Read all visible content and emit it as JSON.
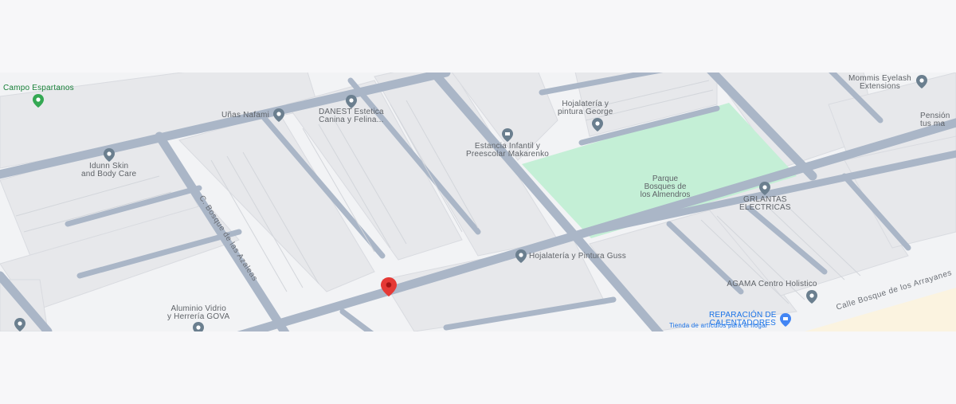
{
  "map": {
    "colors": {
      "background": "#f2f3f5",
      "block": "#e8e9ec",
      "road": "#aab6c7",
      "park": "#c4efd6",
      "pin_gray": "#6b7f8f",
      "pin_red": "#e53935",
      "pin_green": "#34a853",
      "pin_blue": "#4285f4"
    },
    "streets": [
      {
        "name": "C. Bosque de las Azaleas"
      },
      {
        "name": "Calle Bosque de los Arrayanes"
      }
    ],
    "park": {
      "name_line1": "Parque",
      "name_line2": "Bosques de",
      "name_line3": "los Almendros"
    },
    "pois": [
      {
        "line1": "Campo Espartanos",
        "line2": "",
        "icon": "green-pin-icon"
      },
      {
        "line1": "Uñas Nafami",
        "line2": "",
        "icon": "gray-pin-icon"
      },
      {
        "line1": "DANEST Estetica",
        "line2": "Canina y Felina...",
        "icon": "gray-pin-icon"
      },
      {
        "line1": "Idunn Skin",
        "line2": "and Body Care",
        "icon": "gray-pin-icon"
      },
      {
        "line1": "Estancia Infantil y",
        "line2": "Preescolar Makarenko",
        "icon": "school-pin-icon"
      },
      {
        "line1": "Hojalatería y",
        "line2": "pintura George",
        "icon": "gray-pin-icon"
      },
      {
        "line1": "Mommis Eyelash",
        "line2": "Extensions",
        "icon": "gray-pin-icon"
      },
      {
        "line1": "Pensión",
        "line2": "tus ma",
        "icon": ""
      },
      {
        "line1": "GRLANTAS",
        "line2": "ELECTRICAS",
        "icon": "gray-pin-icon"
      },
      {
        "line1": "Hojalatería y Pintura Guss",
        "line2": "",
        "icon": "gray-pin-icon"
      },
      {
        "line1": "AGAMA Centro Holistico",
        "line2": "",
        "icon": "gray-pin-icon"
      },
      {
        "line1": "Aluminio Vidrio",
        "line2": "y Herrería GOVA",
        "icon": "gray-pin-icon"
      },
      {
        "line1": "REPARACIÓN DE",
        "line2": "CALENTADORES",
        "icon": "blue-store-icon"
      },
      {
        "line1": "Tienda de artículos para el hogar",
        "line2": "",
        "icon": ""
      }
    ],
    "selected_marker": {
      "icon": "red-location-pin-icon"
    }
  }
}
